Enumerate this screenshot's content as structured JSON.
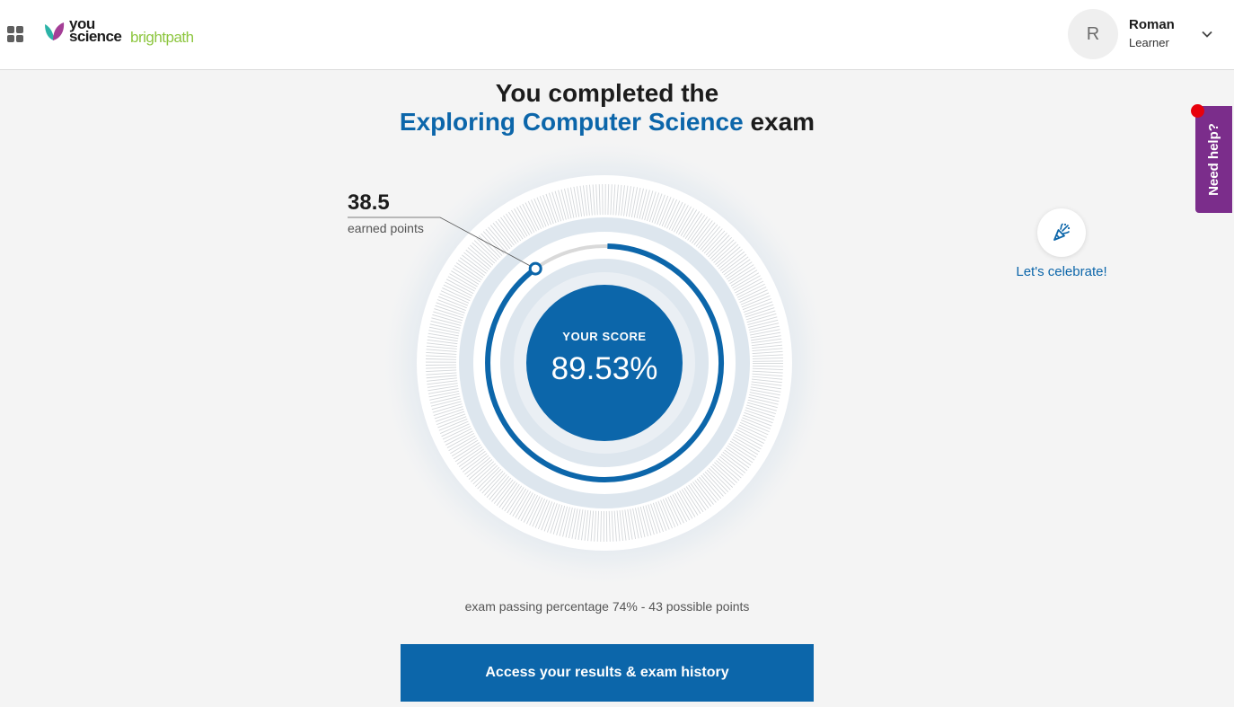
{
  "header": {
    "logo": {
      "you": "you",
      "science": "science",
      "product": "brightpath"
    },
    "user": {
      "initial": "R",
      "name": "Roman",
      "role": "Learner"
    }
  },
  "title": {
    "line1": "You completed the",
    "exam_name": "Exploring Computer Science",
    "suffix": "exam"
  },
  "score": {
    "earned_points": "38.5",
    "earned_label": "earned points",
    "label": "YOUR SCORE",
    "value": "89.53%",
    "percent": 89.53
  },
  "passing_text": "exam passing percentage 74% - 43 possible points",
  "celebrate": {
    "label": "Let's celebrate!"
  },
  "help": {
    "label": "Need help?"
  },
  "cta": {
    "label": "Access your results & exam history"
  },
  "colors": {
    "primary": "#0c66aa",
    "brand_green": "#8dc63f",
    "help_purple": "#7b2d8b",
    "notification_red": "#e8000b"
  },
  "icons": [
    "apps-grid-icon",
    "chevron-down-icon",
    "party-popper-icon"
  ]
}
